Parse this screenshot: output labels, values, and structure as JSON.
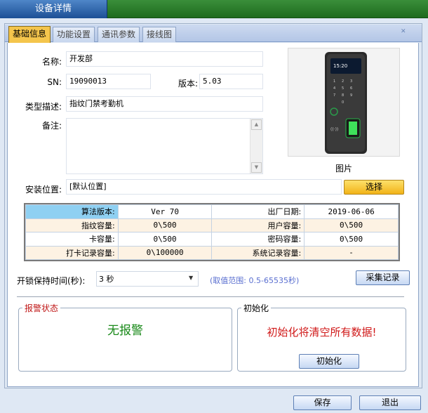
{
  "window": {
    "title": "设备详情"
  },
  "tabs": [
    {
      "label": "基础信息",
      "active": true
    },
    {
      "label": "功能设置",
      "active": false
    },
    {
      "label": "通讯参数",
      "active": false
    },
    {
      "label": "接线图",
      "active": false
    }
  ],
  "basic": {
    "name_label": "名称:",
    "name_value": "开发部",
    "sn_label": "SN:",
    "sn_value": "19090013",
    "version_label": "版本:",
    "version_value": "5.03",
    "type_label": "类型描述:",
    "type_value": "指纹门禁考勤机",
    "note_label": "备注:",
    "note_value": "",
    "location_label": "安装位置:",
    "location_value": "[默认位置]",
    "select_button": "选择"
  },
  "device_photo": {
    "caption": "图片",
    "screen_time": "15:20"
  },
  "info_table": [
    {
      "k1": "算法版本:",
      "v1": "Ver 70",
      "k2": "出厂日期:",
      "v2": "2019-06-06"
    },
    {
      "k1": "指纹容量:",
      "v1": "0\\500",
      "k2": "用户容量:",
      "v2": "0\\500"
    },
    {
      "k1": "卡容量:",
      "v1": "0\\500",
      "k2": "密码容量:",
      "v2": "0\\500"
    },
    {
      "k1": "打卡记录容量:",
      "v1": "0\\100000",
      "k2": "系统记录容量:",
      "v2": "-"
    }
  ],
  "unlock": {
    "label": "开锁保持时间(秒):",
    "value": "3 秒",
    "range_hint": "(取值范围: 0.5-65535秒)",
    "collect_button": "采集记录"
  },
  "alarm": {
    "title": "报警状态",
    "status": "无报警",
    "status_color": "#1a8a1a"
  },
  "init": {
    "title": "初始化",
    "warning": "初始化将清空所有数据!",
    "warning_color": "#d01818",
    "button": "初始化"
  },
  "footer": {
    "save": "保存",
    "exit": "退出"
  },
  "colors": {
    "title_green": "#2e7d2e",
    "tab_active": "#f4c54c",
    "table_highlight": "#8fd0f2"
  }
}
